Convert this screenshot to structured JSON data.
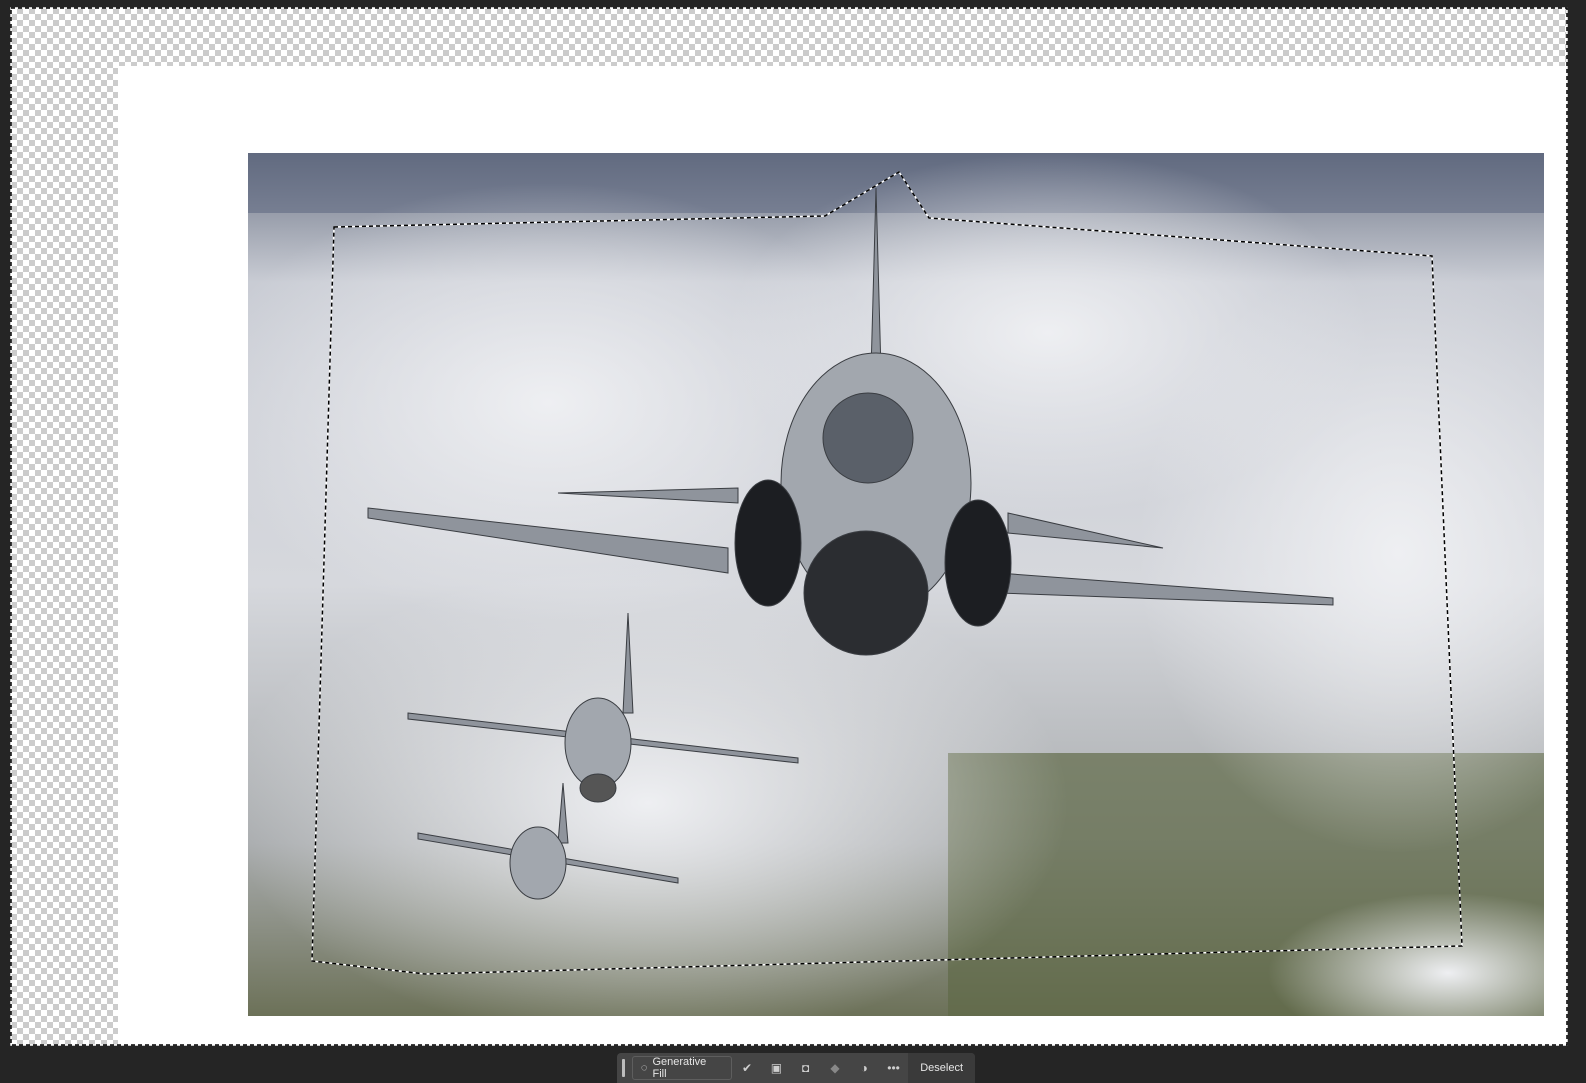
{
  "toolbar": {
    "generative_fill_label": "Generative Fill",
    "deselect_label": "Deselect",
    "icons": [
      "generative-fill-icon",
      "modify-selection-icon",
      "invert-selection-icon",
      "create-mask-icon",
      "fill-selection-icon",
      "adjustment-layer-icon",
      "more-options-icon"
    ]
  },
  "colors": {
    "workspace": "#252525",
    "toolbar": "#454545",
    "marquee": "#000000"
  }
}
